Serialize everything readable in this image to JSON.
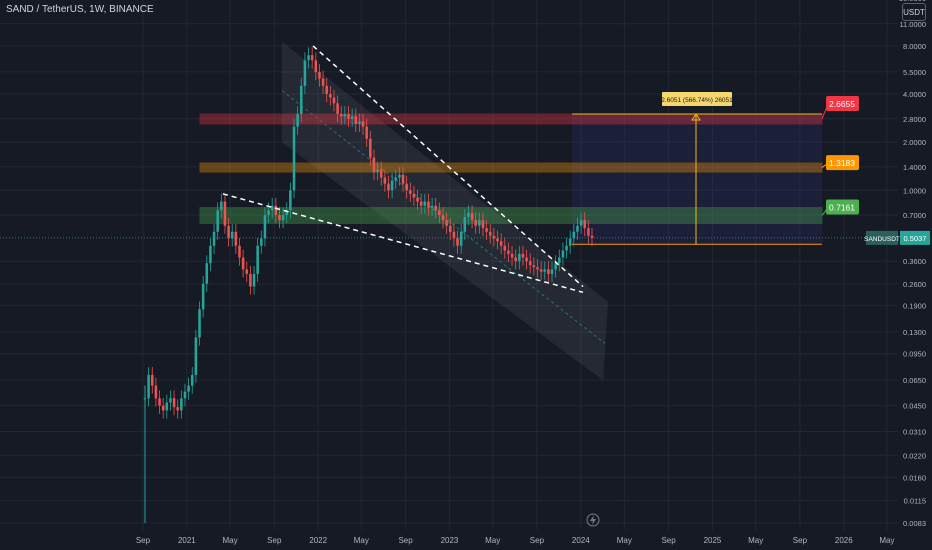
{
  "header": {
    "title": "SAND / TetherUS, 1W, BINANCE",
    "currency": "USDT"
  },
  "chart_data": {
    "type": "candlestick",
    "y_scale": "log",
    "ylim": [
      0.0075,
      15.5
    ],
    "y_ticks": [
      "16.0000",
      "11.0000",
      "8.0000",
      "5.5000",
      "4.0000",
      "2.8000",
      "2.0000",
      "1.4000",
      "1.0000",
      "0.7000",
      "0.5037",
      "0.3600",
      "0.2600",
      "0.1900",
      "0.1300",
      "0.0950",
      "0.0650",
      "0.0450",
      "0.0310",
      "0.0220",
      "0.0160",
      "0.0115",
      "0.0083"
    ],
    "x_ticks": [
      {
        "label": "Sep",
        "date": "2020-09-01"
      },
      {
        "label": "2021",
        "date": "2021-01-01"
      },
      {
        "label": "May",
        "date": "2021-05-01"
      },
      {
        "label": "Sep",
        "date": "2021-09-01"
      },
      {
        "label": "2022",
        "date": "2022-01-01"
      },
      {
        "label": "May",
        "date": "2022-05-01"
      },
      {
        "label": "Sep",
        "date": "2022-09-01"
      },
      {
        "label": "2023",
        "date": "2023-01-01"
      },
      {
        "label": "May",
        "date": "2023-05-01"
      },
      {
        "label": "Sep",
        "date": "2023-09-01"
      },
      {
        "label": "2024",
        "date": "2024-01-01"
      },
      {
        "label": "May",
        "date": "2024-05-01"
      },
      {
        "label": "Sep",
        "date": "2024-09-01"
      },
      {
        "label": "2025",
        "date": "2025-01-01"
      },
      {
        "label": "May",
        "date": "2025-05-01"
      },
      {
        "label": "Sep",
        "date": "2025-09-01"
      },
      {
        "label": "2026",
        "date": "2026-01-01"
      },
      {
        "label": "May",
        "date": "2026-05-01"
      }
    ],
    "last_price": {
      "symbol": "SANDUSDT",
      "value": "0.5037"
    },
    "levels": [
      {
        "label": "2.6655",
        "low": 2.6,
        "high": 3.0,
        "fill": "#f23645",
        "label_color": "#f23645"
      },
      {
        "label": "1.3183",
        "low": 1.3,
        "high": 1.48,
        "fill": "#ff9800",
        "label_color": "#ff9800"
      },
      {
        "label": "0.7161",
        "low": 0.62,
        "high": 0.78,
        "fill": "#4caf50",
        "label_color": "#4caf50"
      }
    ],
    "measure_label": "2.6051 (566.74%) 26051",
    "measure": {
      "from": 0.46,
      "to": 3.0
    },
    "colors": {
      "up": "#26a69a",
      "down": "#ef5350",
      "grid": "#232733",
      "text": "#b2b5be"
    },
    "series": [
      0.05,
      0.07,
      0.06,
      0.05,
      0.045,
      0.042,
      0.047,
      0.05,
      0.044,
      0.042,
      0.05,
      0.055,
      0.06,
      0.07,
      0.12,
      0.18,
      0.26,
      0.35,
      0.45,
      0.55,
      0.75,
      0.85,
      0.6,
      0.5,
      0.55,
      0.45,
      0.38,
      0.32,
      0.3,
      0.25,
      0.3,
      0.45,
      0.5,
      0.7,
      0.75,
      0.8,
      0.7,
      0.65,
      0.7,
      0.75,
      1.0,
      2.5,
      3.0,
      4.5,
      6.5,
      7.0,
      6.5,
      5.5,
      5.0,
      4.5,
      4.0,
      3.8,
      3.5,
      3.0,
      2.9,
      3.0,
      2.8,
      2.9,
      2.6,
      2.7,
      2.5,
      2.1,
      1.6,
      1.3,
      1.35,
      1.2,
      1.1,
      1.0,
      1.15,
      1.2,
      1.25,
      1.1,
      1.0,
      0.95,
      0.9,
      0.85,
      0.8,
      0.85,
      0.78,
      0.8,
      0.75,
      0.7,
      0.65,
      0.6,
      0.55,
      0.5,
      0.45,
      0.55,
      0.68,
      0.72,
      0.65,
      0.6,
      0.65,
      0.58,
      0.55,
      0.52,
      0.5,
      0.48,
      0.45,
      0.42,
      0.4,
      0.38,
      0.36,
      0.4,
      0.38,
      0.36,
      0.34,
      0.33,
      0.32,
      0.31,
      0.32,
      0.3,
      0.32,
      0.35,
      0.38,
      0.42,
      0.45,
      0.5,
      0.55,
      0.6,
      0.65,
      0.58,
      0.52,
      0.5037
    ]
  }
}
